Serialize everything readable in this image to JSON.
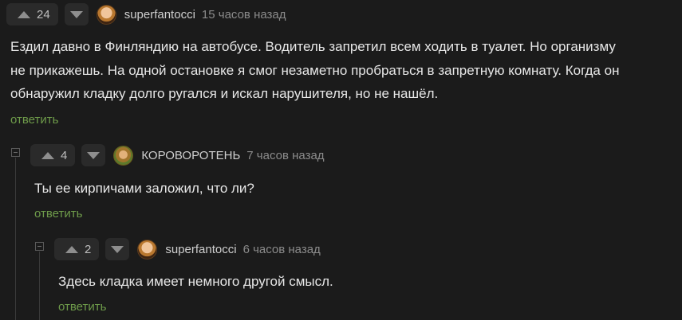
{
  "comments": [
    {
      "votes": "24",
      "username": "superfantocci",
      "time": "15 часов назад",
      "lines": [
        "Ездил давно в Финляндию на автобусе. Водитель запретил всем ходить в туалет. Но организму",
        "не прикажешь. На одной остановке я смог незаметно пробраться в запретную комнату. Когда он",
        "обнаружил кладку долго ругался и искал нарушителя, но не нашёл."
      ],
      "reply": "ответить"
    },
    {
      "votes": "4",
      "username": "КОРОВОРОТЕНЬ",
      "time": "7 часов назад",
      "lines": [
        "Ты ее кирпичами заложил, что ли?"
      ],
      "reply": "ответить"
    },
    {
      "votes": "2",
      "username": "superfantocci",
      "time": "6 часов назад",
      "lines": [
        "Здесь кладка имеет немного другой смысл."
      ],
      "reply": "ответить"
    }
  ],
  "icons": {
    "upvote": "triangle-up-icon",
    "downvote": "triangle-down-icon",
    "collapse": "minus-box-icon"
  },
  "colors": {
    "background": "#1b1b1b",
    "reply_link": "#6e9b4a"
  }
}
